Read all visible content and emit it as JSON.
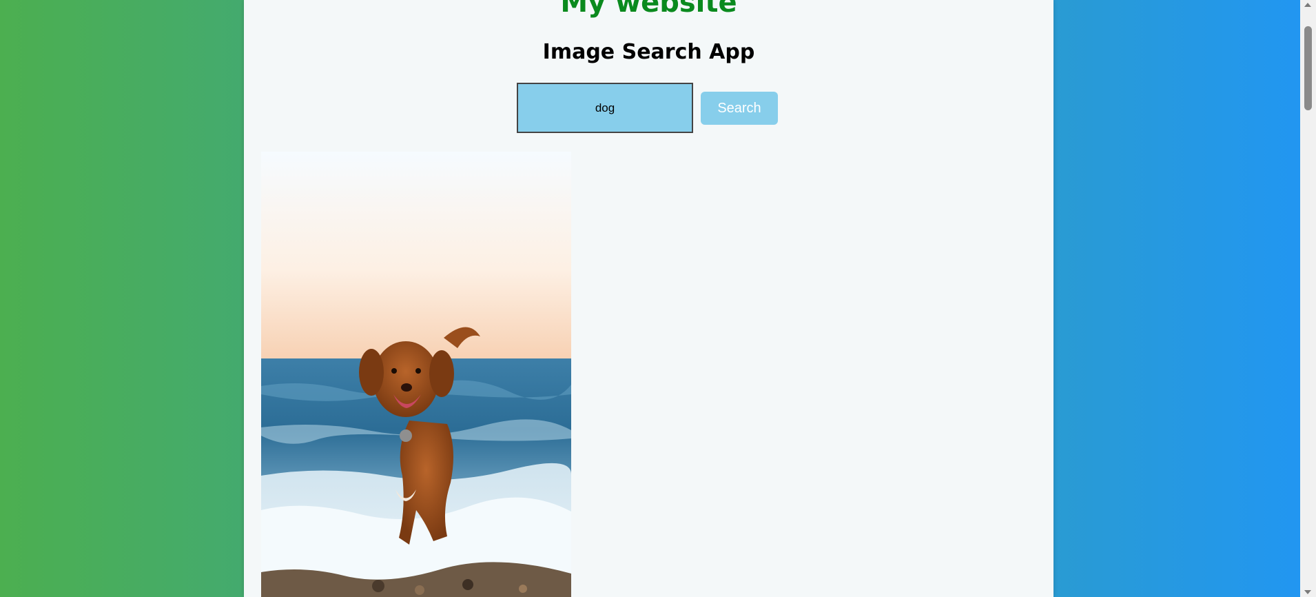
{
  "header": {
    "site_title": "My website",
    "app_title": "Image Search App"
  },
  "search": {
    "value": "dog",
    "button_label": "Search"
  },
  "results": [
    {
      "alt": "dog"
    }
  ],
  "colors": {
    "background_gradient_start": "#4caf50",
    "background_gradient_end": "#2196f3",
    "site_title": "#0a8a1e",
    "input_background": "#87ceeb",
    "button_background": "#87ceeb",
    "page_background": "#f4f8f9"
  }
}
